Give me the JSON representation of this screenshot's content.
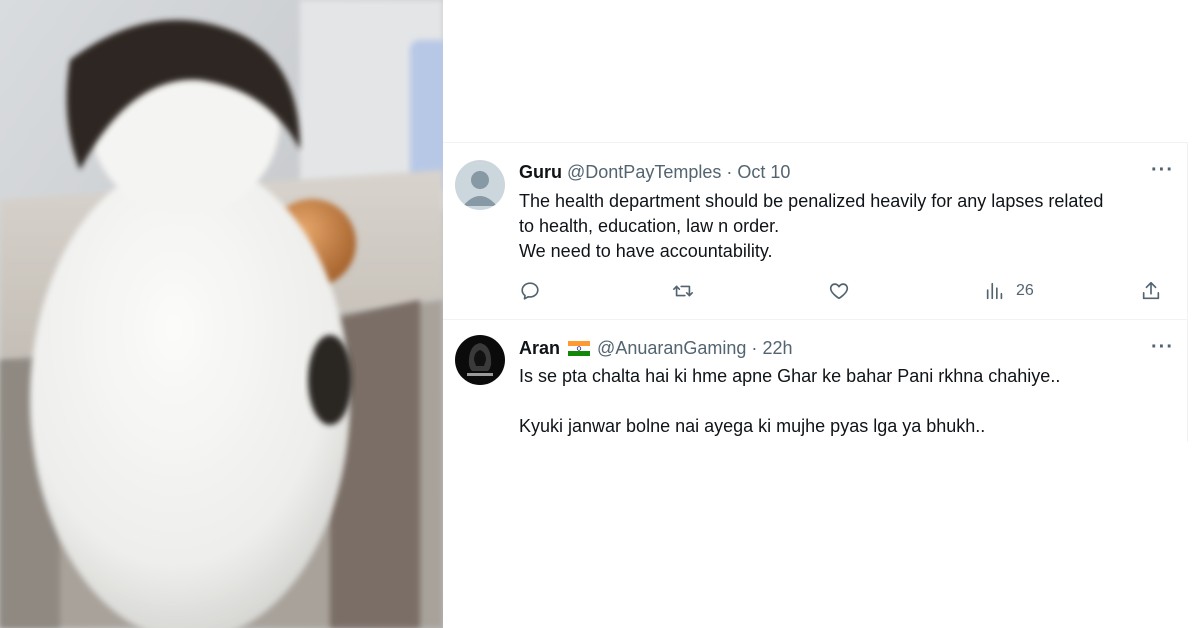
{
  "tweets": [
    {
      "author": "Guru",
      "handle": "@DontPayTemples",
      "separator": "·",
      "time": "Oct 10",
      "more_label": "···",
      "lines": [
        "The health department should be penalized heavily for any lapses related",
        "to health, education, law n order.",
        "We need to have accountability."
      ],
      "actions": {
        "reply_icon": "reply-icon",
        "retweet_icon": "retweet-icon",
        "like_icon": "heart-icon",
        "views_icon": "views-icon",
        "views_count": "26",
        "share_icon": "share-icon"
      }
    },
    {
      "author": "Aran",
      "flag": "india-flag",
      "handle": "@AnuaranGaming",
      "separator": "·",
      "time": "22h",
      "more_label": "···",
      "lines": [
        "Is se pta chalta hai ki hme apne Ghar ke bahar Pani rkhna chahiye..",
        "",
        "Kyuki janwar bolne nai ayega ki mujhe pyas lga ya bhukh.."
      ]
    }
  ],
  "colors": {
    "text_primary": "#0f1419",
    "text_secondary": "#536471",
    "divider": "#eff3f4"
  }
}
